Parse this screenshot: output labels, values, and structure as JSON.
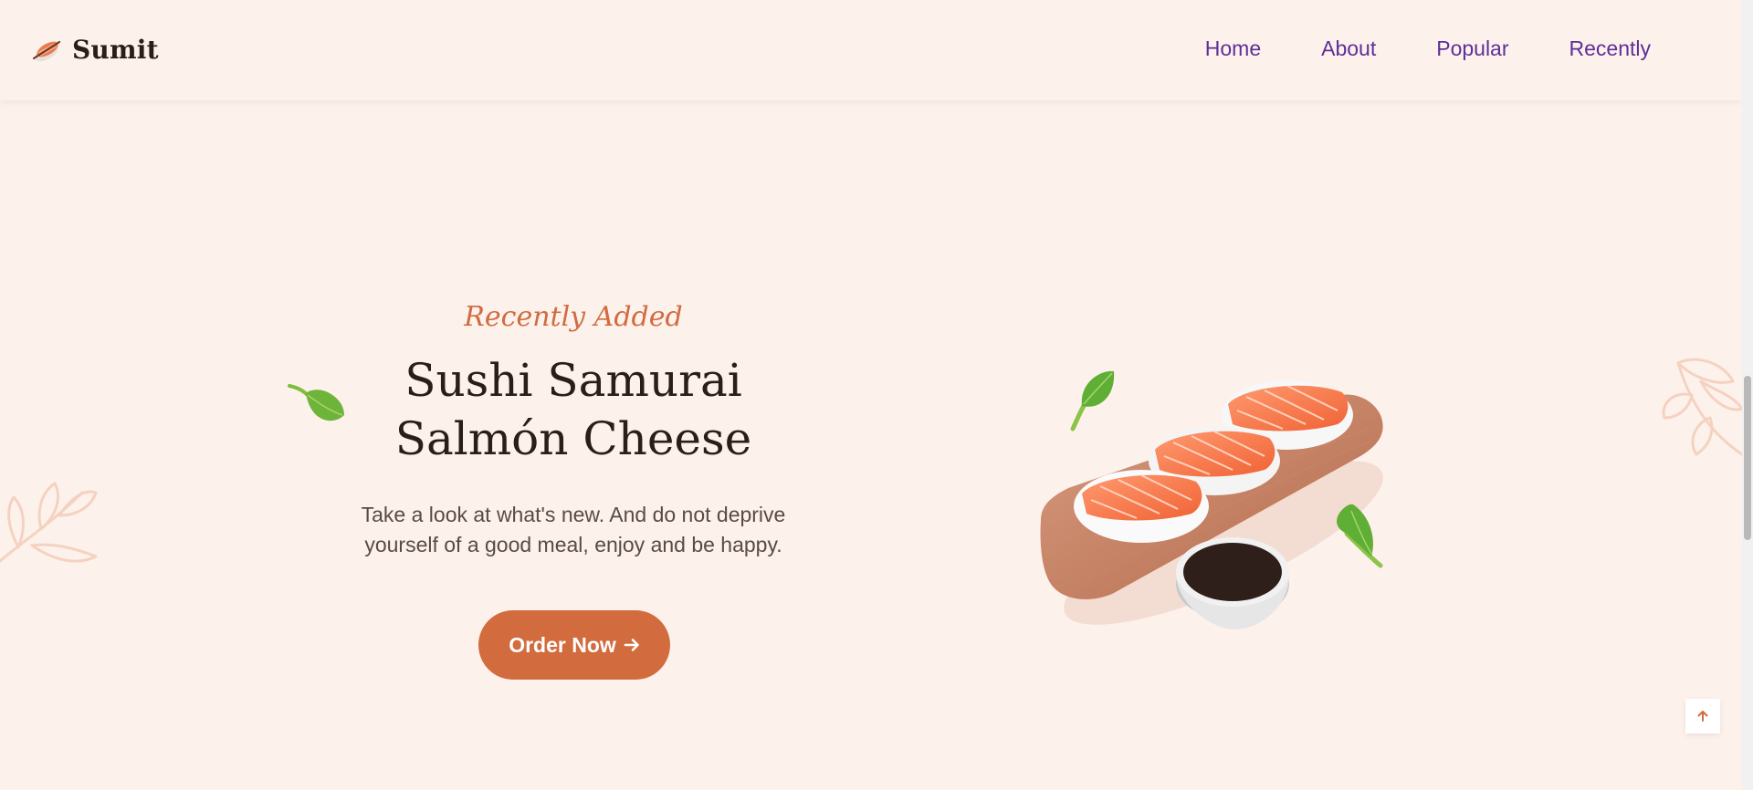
{
  "header": {
    "brand": "Sumit",
    "nav": [
      {
        "label": "Home"
      },
      {
        "label": "About"
      },
      {
        "label": "Popular"
      },
      {
        "label": "Recently"
      }
    ]
  },
  "hero": {
    "subtitle": "Recently Added",
    "title_line1": "Sushi Samurai",
    "title_line2": "Salmón Cheese",
    "description": "Take a look at what's new. And do not deprive yourself of a good meal, enjoy and be happy.",
    "button_label": "Order Now"
  },
  "icons": {
    "logo": "sushi-logo-icon",
    "button_arrow": "arrow-right-icon",
    "scroll_top": "arrow-up-icon"
  },
  "colors": {
    "background": "#fdf1ec",
    "accent": "#d26c3f",
    "nav_link": "#5e2f98",
    "heading": "#2a1e1a",
    "leaf_green": "#7bbf3a",
    "leaf_outline": "#f5d2c0"
  }
}
